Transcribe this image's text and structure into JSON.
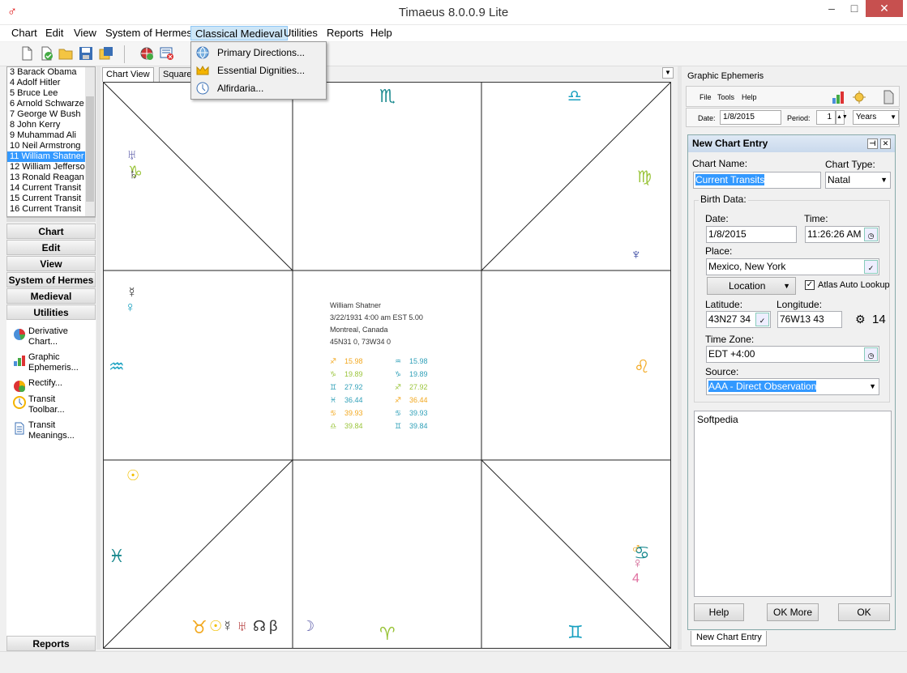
{
  "window": {
    "title": "Timaeus 8.0.0.9 Lite"
  },
  "menu": [
    "Chart",
    "Edit",
    "View",
    "System of Hermes",
    "Classical Medieval",
    "Utilities",
    "Reports",
    "Help"
  ],
  "dropdown": [
    "Primary Directions...",
    "Essential Dignities...",
    "Alfirdaria..."
  ],
  "chart_list": [
    "3 Barack Obama",
    "4 Adolf Hitler",
    "5 Bruce Lee",
    "6 Arnold Schwarze",
    "7 George W Bush",
    "8 John Kerry",
    "9 Muhammad Ali",
    "10 Neil Armstrong",
    "11 William Shatner",
    "12 William Jefferso",
    "13 Ronald Reagan",
    "14 Current Transit",
    "15 Current Transit",
    "16 Current Transit"
  ],
  "nav_buttons": [
    "Chart",
    "Edit",
    "View",
    "System of Hermes",
    "Medieval",
    "Utilities"
  ],
  "nav_items": [
    {
      "line1": "Derivative",
      "line2": "Chart...",
      "icon": "pie-chart-icon"
    },
    {
      "line1": "Graphic",
      "line2": "Ephemeris...",
      "icon": "bar-chart-icon"
    },
    {
      "line1": "Rectify...",
      "line2": "",
      "icon": "pie-check-icon"
    },
    {
      "line1": "Transit",
      "line2": "Toolbar...",
      "icon": "clock-icon"
    },
    {
      "line1": "Transit",
      "line2": "Meanings...",
      "icon": "document-icon"
    }
  ],
  "reports_button": "Reports",
  "tabs": [
    "Chart View",
    "Square"
  ],
  "chart_info": {
    "name": "William Shatner",
    "date": "3/22/1931   4:00 am   EST 5.00",
    "place": "Montreal, Canada",
    "coords": "45N31 0,  73W34 0",
    "rows": [
      {
        "g1": "♐",
        "c1": "#f2a81f",
        "v1": "15.98",
        "g2": "♒",
        "c2": "#30a0b8",
        "v2": "15.98"
      },
      {
        "g1": "♑",
        "c1": "#9ac43a",
        "v1": "19.89",
        "g2": "♑",
        "c2": "#30a0b8",
        "v2": "19.89"
      },
      {
        "g1": "♊",
        "c1": "#30a0b8",
        "v1": "27.92",
        "g2": "♐",
        "c2": "#9ac43a",
        "v2": "27.92"
      },
      {
        "g1": "♓",
        "c1": "#30a0b8",
        "v1": "36.44",
        "g2": "♐",
        "c2": "#f2a81f",
        "v2": "36.44"
      },
      {
        "g1": "♋",
        "c1": "#f2a81f",
        "v1": "39.93",
        "g2": "♋",
        "c2": "#30a0b8",
        "v2": "39.93"
      },
      {
        "g1": "♎",
        "c1": "#9ac43a",
        "v1": "39.84",
        "g2": "♊",
        "c2": "#30a0b8",
        "v2": "39.84"
      }
    ]
  },
  "chart_glyphs": {
    "scorpio": "♏",
    "libra": "♎",
    "sagittarius": "♐",
    "neptune": "♆",
    "uranus": "♅",
    "saturn": "♄",
    "capricorn": "♑",
    "venus": "♀",
    "mercury": "☿",
    "aquarius": "♒",
    "leo": "♌",
    "sun": "☉",
    "pisces": "♓",
    "taurus": "♉",
    "moon": "☽",
    "north_node": "☊",
    "beta": "β",
    "gemini": "♊",
    "cancer": "♋",
    "mars": "♂",
    "jupiter": "4",
    "aries": "♈",
    "virgo": "♍"
  },
  "graphic_ephemeris": {
    "title": "Graphic Ephemeris",
    "menu": [
      "File",
      "Tools",
      "Help"
    ],
    "date_label": "Date:",
    "date": "1/8/2015",
    "period_label": "Period:",
    "period": "1",
    "unit": "Years"
  },
  "nce": {
    "title": "New Chart Entry",
    "chart_name_label": "Chart Name:",
    "chart_name": "Current Transits",
    "chart_type_label": "Chart Type:",
    "chart_type": "Natal",
    "birth_data_label": "Birth Data:",
    "date_label": "Date:",
    "date": "1/8/2015",
    "time_label": "Time:",
    "time": "11:26:26 AM",
    "place_label": "Place:",
    "place": "Mexico, New York",
    "location_btn": "Location",
    "atlas_label": "Atlas Auto Lookup",
    "latitude_label": "Latitude:",
    "latitude": "43N27 34",
    "longitude_label": "Longitude:",
    "longitude": "76W13 43",
    "degree_value": "14",
    "timezone_label": "Time Zone:",
    "timezone": "EDT +4:00",
    "source_label": "Source:",
    "source": "AAA - Direct Observation",
    "notes": "Softpedia",
    "help_btn": "Help",
    "okmore_btn": "OK More",
    "ok_btn": "OK"
  },
  "bottom_tab": "New Chart Entry"
}
